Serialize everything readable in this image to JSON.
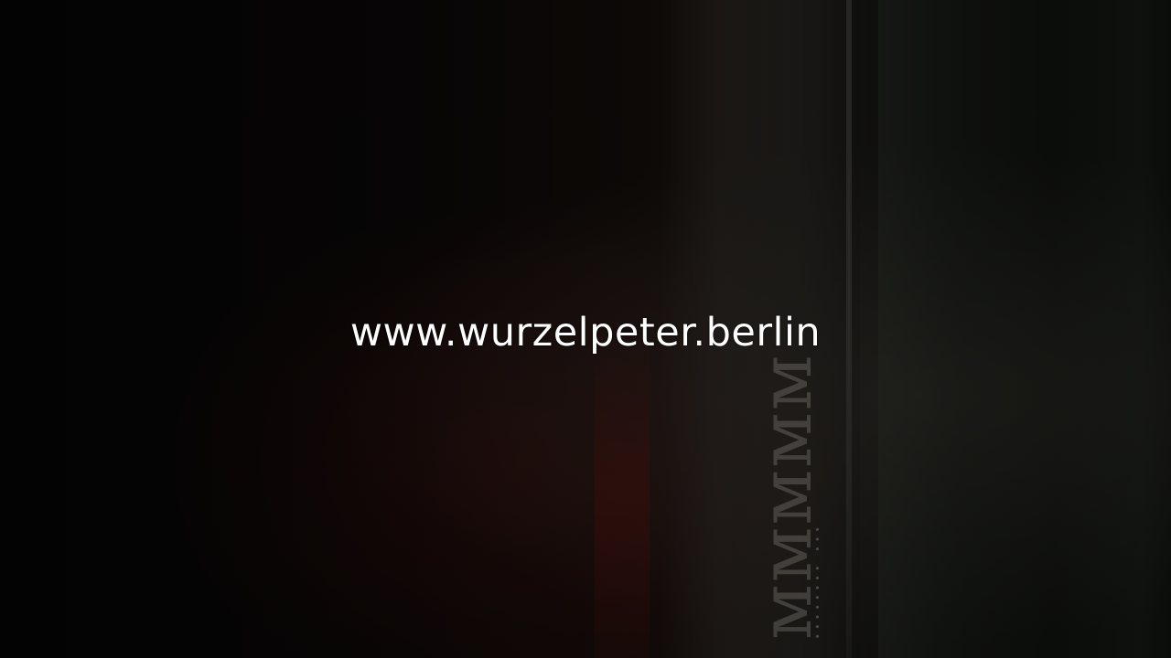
{
  "caption": {
    "url": "www.wurzelpeter.berlin"
  },
  "colors": {
    "background": "#050505",
    "caption_text": "#ffffff"
  }
}
